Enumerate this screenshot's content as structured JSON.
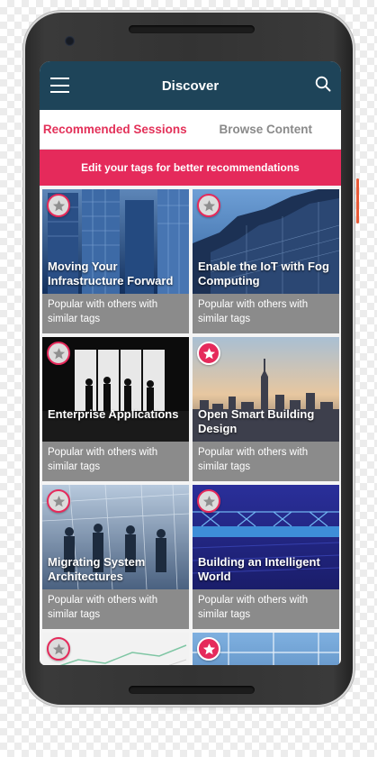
{
  "appbar": {
    "title": "Discover"
  },
  "tabs": [
    {
      "label": "Recommended Sessions",
      "active": true
    },
    {
      "label": "Browse Content",
      "active": false
    }
  ],
  "banner": {
    "text": "Edit your tags for better recommendations"
  },
  "cards": [
    {
      "title": "Moving Your Infrastructure Forward",
      "footer": "Popular with others with similar tags",
      "favorited": false
    },
    {
      "title": "Enable the IoT with Fog Computing",
      "footer": "Popular with others with similar tags",
      "favorited": false
    },
    {
      "title": "Enterprise Applications",
      "footer": "Popular with others with similar tags",
      "favorited": false
    },
    {
      "title": "Open Smart Building Design",
      "footer": "Popular with others with similar tags",
      "favorited": true
    },
    {
      "title": "Migrating System Architectures",
      "footer": "Popular with others with similar tags",
      "favorited": false
    },
    {
      "title": "Building an Intelligent World",
      "footer": "Popular with others with similar tags",
      "favorited": false
    },
    {
      "title": "",
      "footer": "",
      "favorited": false
    },
    {
      "title": "",
      "footer": "",
      "favorited": true
    }
  ],
  "colors": {
    "appbar": "#1e4459",
    "accent": "#e52a5b",
    "tab_inactive": "#8a8a8a",
    "card_footer": "#8b8b8b"
  },
  "icons": {
    "menu": "hamburger-icon",
    "search": "search-icon",
    "favorite": "star-icon"
  }
}
